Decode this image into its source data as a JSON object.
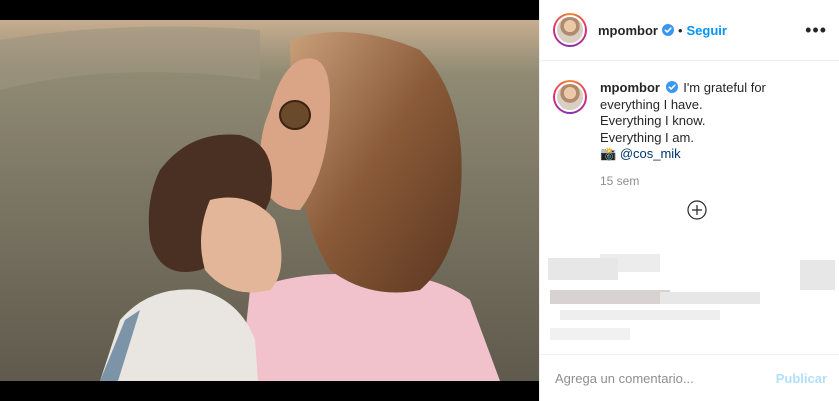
{
  "post": {
    "username": "mpombor",
    "follow_label": "Seguir",
    "separator": "•",
    "more_icon": "more-horizontal-icon",
    "verified_icon": "verified-badge-icon"
  },
  "caption": {
    "username": "mpombor",
    "line1": "I'm grateful for everything I have.",
    "line2": "Everything I know.",
    "line3": "Everything I am.",
    "camera_emoji": "📸",
    "mention": "@cos_mik",
    "time": "15 sem"
  },
  "comment": {
    "placeholder": "Agrega un comentario...",
    "post_label": "Publicar"
  },
  "colors": {
    "accent": "#0095f6",
    "post_disabled": "#b2dffc",
    "meta": "#8e8e8e",
    "text": "#262626"
  }
}
